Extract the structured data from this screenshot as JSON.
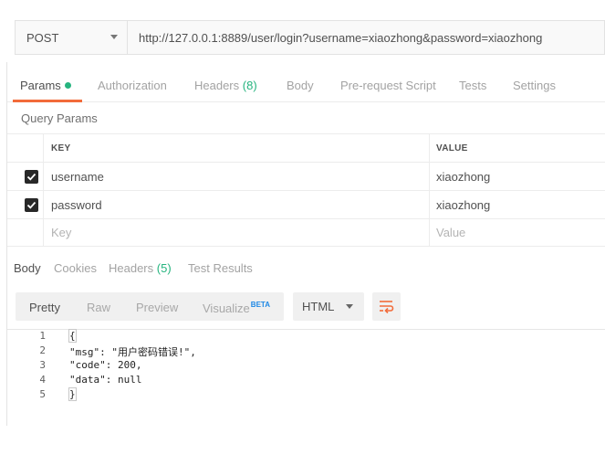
{
  "request": {
    "method": "POST",
    "url": "http://127.0.0.1:8889/user/login?username=xiaozhong&password=xiaozhong"
  },
  "request_tabs": [
    {
      "label": "Params",
      "count": "",
      "active": true,
      "dot": true
    },
    {
      "label": "Authorization",
      "count": ""
    },
    {
      "label": "Headers",
      "count": "(8)"
    },
    {
      "label": "Body",
      "count": ""
    },
    {
      "label": "Pre-request Script",
      "count": ""
    },
    {
      "label": "Tests",
      "count": ""
    },
    {
      "label": "Settings",
      "count": ""
    }
  ],
  "query_params": {
    "title": "Query Params",
    "headers": {
      "key": "KEY",
      "value": "VALUE"
    },
    "rows": [
      {
        "key": "username",
        "value": "xiaozhong",
        "checked": true
      },
      {
        "key": "password",
        "value": "xiaozhong",
        "checked": true
      }
    ],
    "placeholder": {
      "key": "Key",
      "value": "Value"
    }
  },
  "response_tabs": [
    {
      "label": "Body",
      "active": true
    },
    {
      "label": "Cookies"
    },
    {
      "label": "Headers",
      "count": "(5)"
    },
    {
      "label": "Test Results"
    }
  ],
  "response_toolbar": {
    "views": [
      "Pretty",
      "Raw",
      "Preview",
      "Visualize"
    ],
    "visualize_badge": "BETA",
    "active_view": "Pretty",
    "language": "HTML"
  },
  "response_body": {
    "lines": [
      {
        "n": "1",
        "text": "{"
      },
      {
        "n": "2",
        "text": "\"msg\": \"用户密码错误!\","
      },
      {
        "n": "3",
        "text": "\"code\": 200,"
      },
      {
        "n": "4",
        "text": "\"data\": null"
      },
      {
        "n": "5",
        "text": "}"
      }
    ]
  },
  "colors": {
    "accent": "#f26b3a",
    "count_green": "#26b47f",
    "beta_blue": "#1e88e5"
  },
  "icons": {
    "method_dropdown": "chevron-down-icon",
    "checkbox": "checkbox-checked-icon",
    "wrap": "wrap-lines-icon"
  }
}
